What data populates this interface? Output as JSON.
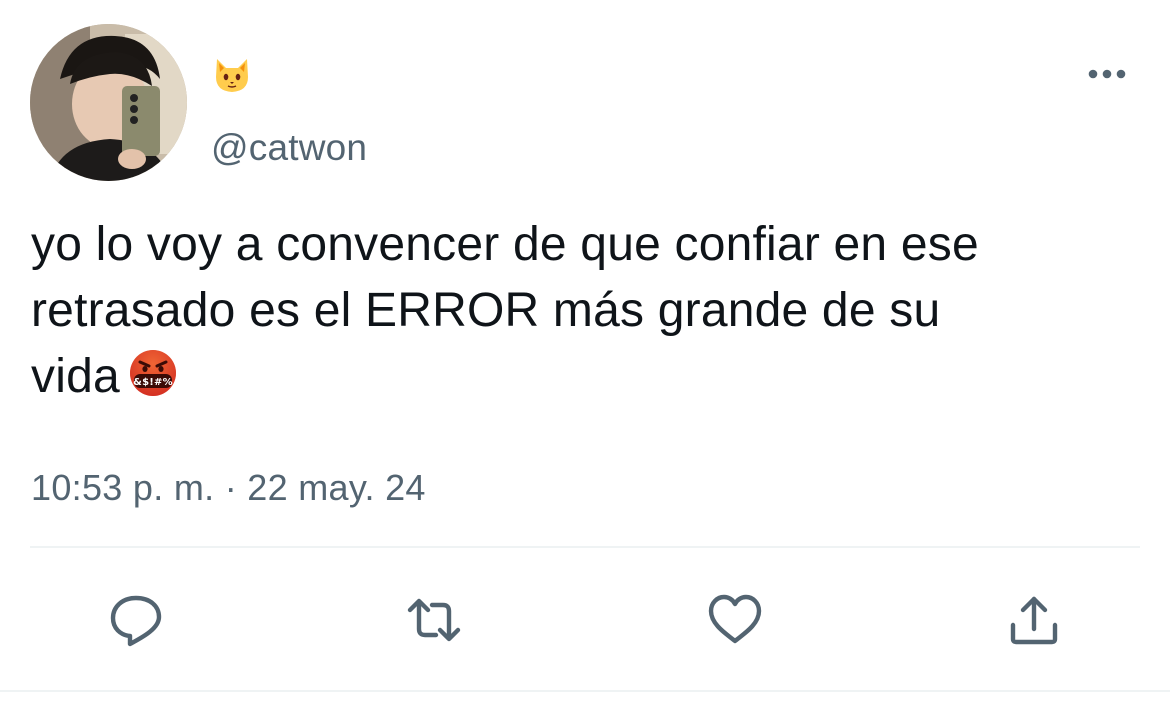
{
  "user": {
    "display_name_icon": "cat-face-emoji",
    "handle": "@catwon",
    "avatar_icon": "profile-photo"
  },
  "tweet": {
    "text_line_1": "yo lo voy a convencer de que confiar en ese",
    "text_line_2": "retrasado es el ERROR más grande de su",
    "text_line_3": "vida",
    "trailing_emoji_icon": "face-with-symbols-on-mouth-emoji",
    "timestamp": "10:53 p. m. · 22 may. 24"
  },
  "toolbar": {
    "more_icon": "more-options-icon",
    "actions": [
      {
        "name": "reply",
        "icon": "reply-icon"
      },
      {
        "name": "retweet",
        "icon": "retweet-icon"
      },
      {
        "name": "like",
        "icon": "heart-icon"
      },
      {
        "name": "share",
        "icon": "share-icon"
      }
    ]
  },
  "colors": {
    "text": "#0f1419",
    "secondary": "#536471",
    "divider": "#eff3f4"
  }
}
